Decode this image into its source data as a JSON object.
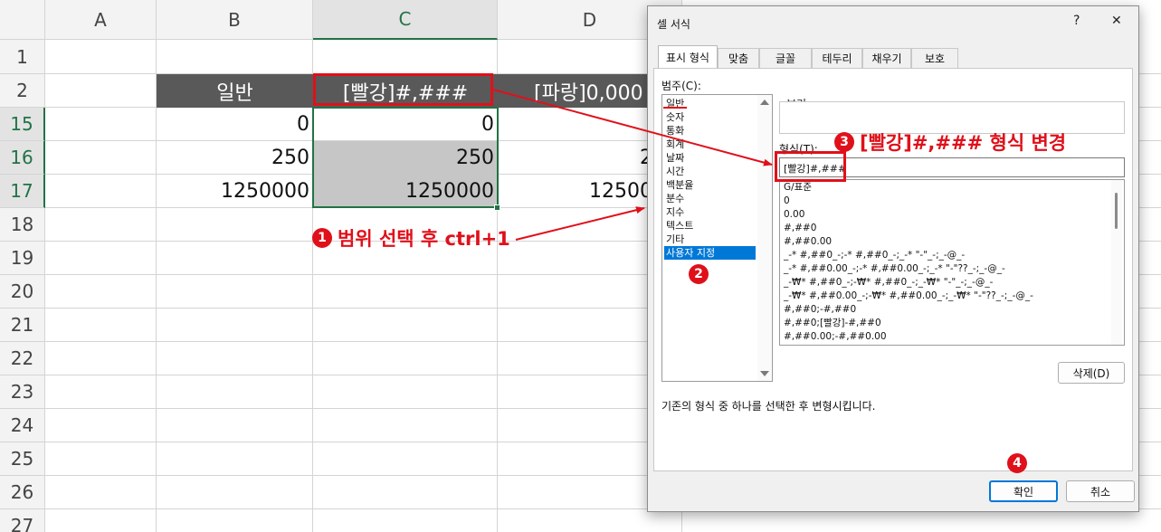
{
  "sheet": {
    "columns": [
      "A",
      "B",
      "C",
      "D"
    ],
    "rows": [
      "1",
      "2",
      "15",
      "16",
      "17",
      "18",
      "19",
      "20",
      "21",
      "22",
      "23",
      "24",
      "25",
      "26",
      "27"
    ],
    "header_row": {
      "b": "일반",
      "c": "[빨강]#,###",
      "d": "[파랑]0,000"
    },
    "data": [
      {
        "b": "0",
        "c": "0",
        "d": ""
      },
      {
        "b": "250",
        "c": "250",
        "d": "2"
      },
      {
        "b": "1250000",
        "c": "1250000",
        "d": "12500"
      }
    ]
  },
  "dialog": {
    "title": "셀 서식",
    "help_icon": "?",
    "close_icon": "✕",
    "tabs": [
      "표시 형식",
      "맞춤",
      "글꼴",
      "테두리",
      "채우기",
      "보호"
    ],
    "category_label": "범주(C):",
    "categories": [
      "일반",
      "숫자",
      "통화",
      "회계",
      "날짜",
      "시간",
      "백분율",
      "분수",
      "지수",
      "텍스트",
      "기타",
      "사용자 지정"
    ],
    "selected_category": "사용자 지정",
    "sample_label": "보기",
    "format_label": "형식(T):",
    "format_value": "[빨강]#,###",
    "format_list": [
      "G/표준",
      "0",
      "0.00",
      "#,##0",
      "#,##0.00",
      "_-* #,##0_-;-* #,##0_-;_-* \"-\"_-;_-@_-",
      "_-* #,##0.00_-;-* #,##0.00_-;_-* \"-\"??_-;_-@_-",
      "_-₩* #,##0_-;-₩* #,##0_-;_-₩* \"-\"_-;_-@_-",
      "_-₩* #,##0.00_-;-₩* #,##0.00_-;_-₩* \"-\"??_-;_-@_-",
      "#,##0;-#,##0",
      "#,##0;[빨강]-#,##0",
      "#,##0.00;-#,##0.00"
    ],
    "delete_button": "삭제(D)",
    "description": "기존의 형식 중 하나를 선택한 후 변형시킵니다.",
    "ok_button": "확인",
    "cancel_button": "취소"
  },
  "annotations": {
    "step1": {
      "number": "1",
      "text": "범위 선택 후 ctrl+1"
    },
    "step2": {
      "number": "2"
    },
    "step3": {
      "number": "3",
      "text": "[빨강]#,### 형식 변경"
    },
    "step4": {
      "number": "4"
    },
    "color": "#e0101a"
  }
}
